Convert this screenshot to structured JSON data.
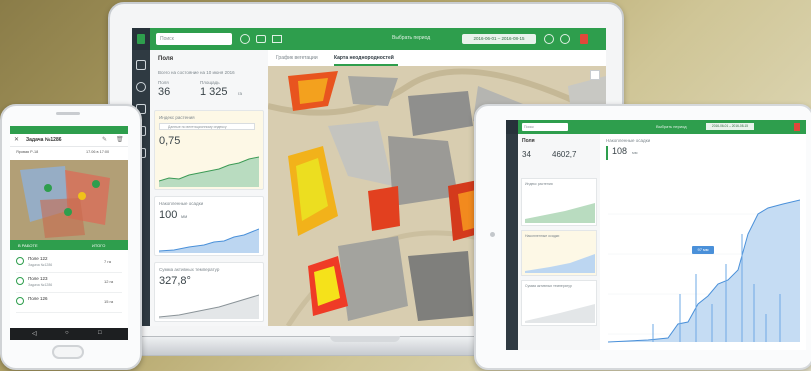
{
  "colors": {
    "brand_green": "#2e9e4d",
    "sidebar_dark": "#2f3a42",
    "chart_blue": "#4a90d9",
    "ndvi_red": "#d9341e",
    "ndvi_orange": "#f08a1c",
    "ndvi_yellow": "#f2e21a"
  },
  "laptop": {
    "search_placeholder": "Поиск",
    "period_label": "Выбрать период",
    "date_range": "2016-06-01 – 2016-08-15",
    "panel": {
      "title": "Поля",
      "summary_title": "Всего на состояние на 10 июня 2016",
      "fields_label": "Поля",
      "fields_value": "36",
      "area_label": "Площадь",
      "area_value": "1 325",
      "area_unit": "га",
      "cards": [
        {
          "title": "Индекс растения",
          "note": "Данные по вегетационному индексу",
          "value": "0,75"
        },
        {
          "title": "Накопленные осадки",
          "value": "100",
          "unit": "мм"
        },
        {
          "title": "Сумма активных температур",
          "value": "327,8°"
        }
      ]
    },
    "tabs": [
      "График вегетации",
      "Карта неоднородностей"
    ]
  },
  "tablet": {
    "search_placeholder": "Поиск",
    "period_label": "Выбрать период",
    "date_range": "2016-06-01 – 2016-08-15",
    "panel_title": "Поля",
    "summary_fields": "34",
    "summary_area": "4602,7",
    "main_title": "Накопленные осадки",
    "main_value": "108",
    "main_unit": "мм",
    "tooltip": "97 мм",
    "cards": [
      "Индекс растения",
      "Накопленные осадки",
      "Сумма активных температур"
    ]
  },
  "phone": {
    "title": "Задача №1286",
    "crop": "Яровая Р-18",
    "date": "17.06 в 17:00",
    "filter_left": "В РАБОТЕ",
    "filter_right": "ИТОГО",
    "fields": [
      {
        "name": "Поле 122",
        "sub": "Задача №1286",
        "area": "7 га"
      },
      {
        "name": "Поле 123",
        "sub": "Задача №1286",
        "area": "12 га"
      },
      {
        "name": "Поле 126",
        "sub": "",
        "area": "15 га"
      }
    ]
  }
}
